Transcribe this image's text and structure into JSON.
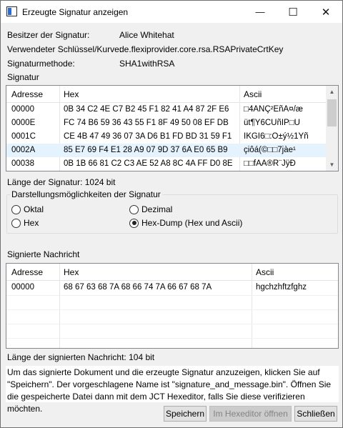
{
  "window": {
    "title": "Erzeugte Signatur anzeigen",
    "minimize_glyph": "—",
    "maximize_glyph": "☐",
    "close_glyph": "✕"
  },
  "info": {
    "owner_label": "Besitzer der Signatur:",
    "owner_value": "Alice Whitehat",
    "key_label": "Verwendeter Schlüssel/Kurve:",
    "key_value": "de.flexiprovider.core.rsa.RSAPrivateCrtKey",
    "method_label": "Signaturmethode:",
    "method_value": "SHA1withRSA"
  },
  "signature": {
    "section_label": "Signatur",
    "columns": [
      "Adresse",
      "Hex",
      "Ascii"
    ],
    "rows": [
      {
        "addr": "00000",
        "hex": "0B 34 C2 4E C7 B2 45 F1 82 41 A4 87 2F E6",
        "ascii": "□4ÂNÇ²EñA¤/æ"
      },
      {
        "addr": "0000E",
        "hex": "FC 74 B6 59 36 43 55 F1 8F 49 50 08 EF DB",
        "ascii": "üt¶Y6CUñIP□Û"
      },
      {
        "addr": "0001C",
        "hex": "CE 4B 47 49 36 07 3A D6 B1 FD BD 31 59 F1",
        "ascii": "ÎKGI6□:Ö±ý½1Yñ"
      },
      {
        "addr": "0002A",
        "hex": "85 E7 69 F4 E1 28 A9 07 9D 37 6A E0 65 B9",
        "ascii": "çiôá(©□□7jàe¹"
      },
      {
        "addr": "00038",
        "hex": "0B 1B 66 81 C2 C3 AE 52 A8 8C 4A FF D0 8E",
        "ascii": "□□fÂÃ®R¨JÿÐ"
      }
    ],
    "selected_row": 3,
    "length_text": "Länge der Signatur: 1024 bit"
  },
  "display_options": {
    "group_title": "Darstellungsmöglichkeiten der Signatur",
    "oktal": "Oktal",
    "dezimal": "Dezimal",
    "hex": "Hex",
    "hexdump": "Hex-Dump (Hex und Ascii)",
    "selected": "hexdump"
  },
  "message": {
    "section_label": "Signierte Nachricht",
    "columns": [
      "Adresse",
      "Hex",
      "Ascii"
    ],
    "rows": [
      {
        "addr": "00000",
        "hex": "68 67 63 68 7A 68 66 74 7A 66 67 68 7A",
        "ascii": "hgchzhftzfghz"
      }
    ],
    "length_text": "Länge der signierten Nachricht: 104 bit"
  },
  "hint_text": "Um das signierte Dokument und die erzeugte Signatur anzuzeigen, klicken Sie auf \"Speichern\". Der vorgeschlagene Name ist \"signature_and_message.bin\". Öffnen Sie die gespeicherte Datei dann mit dem JCT Hexeditor, falls Sie diese verifizieren möchten.",
  "buttons": {
    "save": "Speichern",
    "open_hex": "Im Hexeditor öffnen",
    "close": "Schließen"
  }
}
